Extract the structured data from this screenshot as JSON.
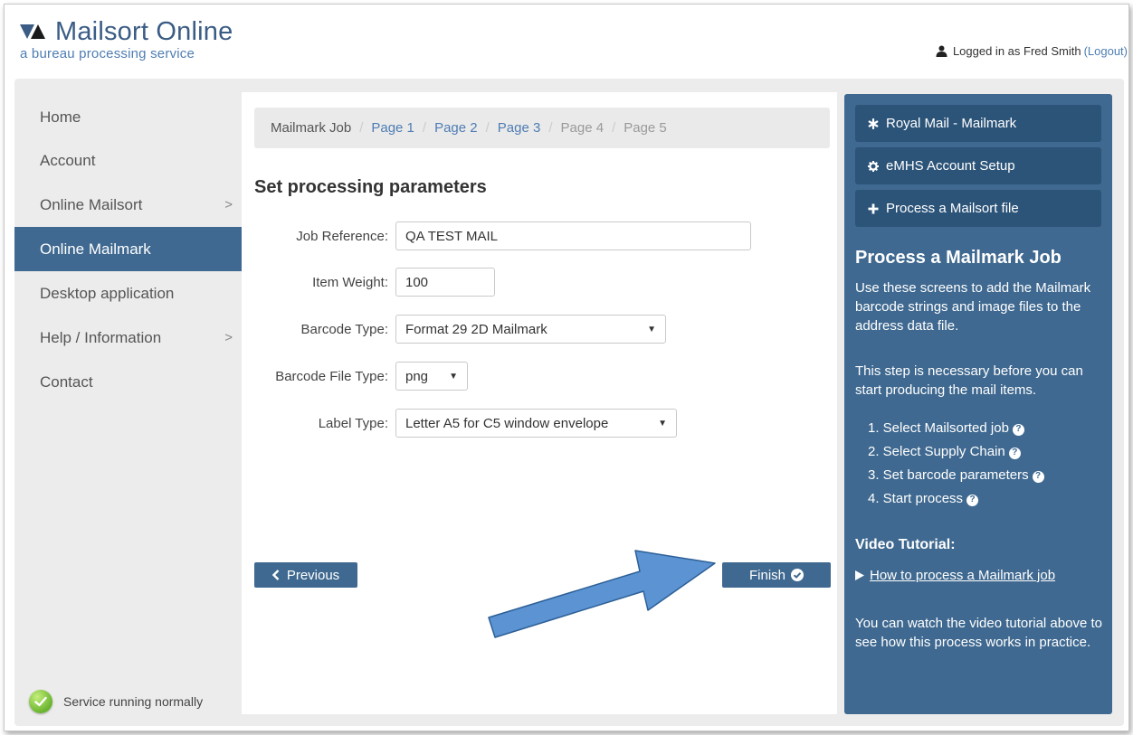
{
  "header": {
    "logo_title": "Mailsort Online",
    "logo_subtitle": "a bureau processing service",
    "logged_in_text": "Logged in as Fred Smith",
    "logout_label": "(Logout)"
  },
  "sidebar": {
    "items": [
      {
        "label": "Home"
      },
      {
        "label": "Account"
      },
      {
        "label": "Online Mailsort",
        "chevron": ">"
      },
      {
        "label": "Online Mailmark",
        "active": true
      },
      {
        "label": "Desktop application"
      },
      {
        "label": "Help / Information",
        "chevron": ">"
      },
      {
        "label": "Contact"
      }
    ],
    "service_status": "Service running normally"
  },
  "breadcrumb": {
    "items": [
      "Mailmark Job",
      "Page 1",
      "Page 2",
      "Page 3",
      "Page 4",
      "Page 5"
    ],
    "separator": "/"
  },
  "form": {
    "heading": "Set processing parameters",
    "job_reference": {
      "label": "Job Reference:",
      "value": "QA TEST MAIL"
    },
    "item_weight": {
      "label": "Item Weight:",
      "value": "100"
    },
    "barcode_type": {
      "label": "Barcode Type:",
      "value": "Format 29 2D Mailmark"
    },
    "barcode_file_type": {
      "label": "Barcode File Type:",
      "value": "png"
    },
    "label_type": {
      "label": "Label Type:",
      "value": "Letter A5 for C5 window envelope"
    }
  },
  "buttons": {
    "previous": "Previous",
    "finish": "Finish"
  },
  "right_panel": {
    "links": [
      {
        "label": "Royal Mail - Mailmark",
        "icon": "asterisk-icon"
      },
      {
        "label": "eMHS Account Setup",
        "icon": "gear-icon"
      },
      {
        "label": "Process a Mailsort file",
        "icon": "plus-icon"
      }
    ],
    "title": "Process a Mailmark Job",
    "intro": "Use these screens to add the Mailmark barcode strings and image files to the address data file.",
    "note": "This step is necessary before you can start producing the mail items.",
    "steps": [
      "1. Select Mailsorted job",
      "2. Select Supply Chain",
      "3. Set barcode parameters",
      "4. Start process"
    ],
    "video_title": "Video Tutorial:",
    "video_link": "How to process a Mailmark job",
    "video_text": "You can watch the video tutorial above to see how this process works in practice."
  },
  "colors": {
    "accent": "#3f6990",
    "accent_dark": "#2c5479",
    "link": "#4f7db3",
    "annotation_arrow": "#5b93d3"
  }
}
